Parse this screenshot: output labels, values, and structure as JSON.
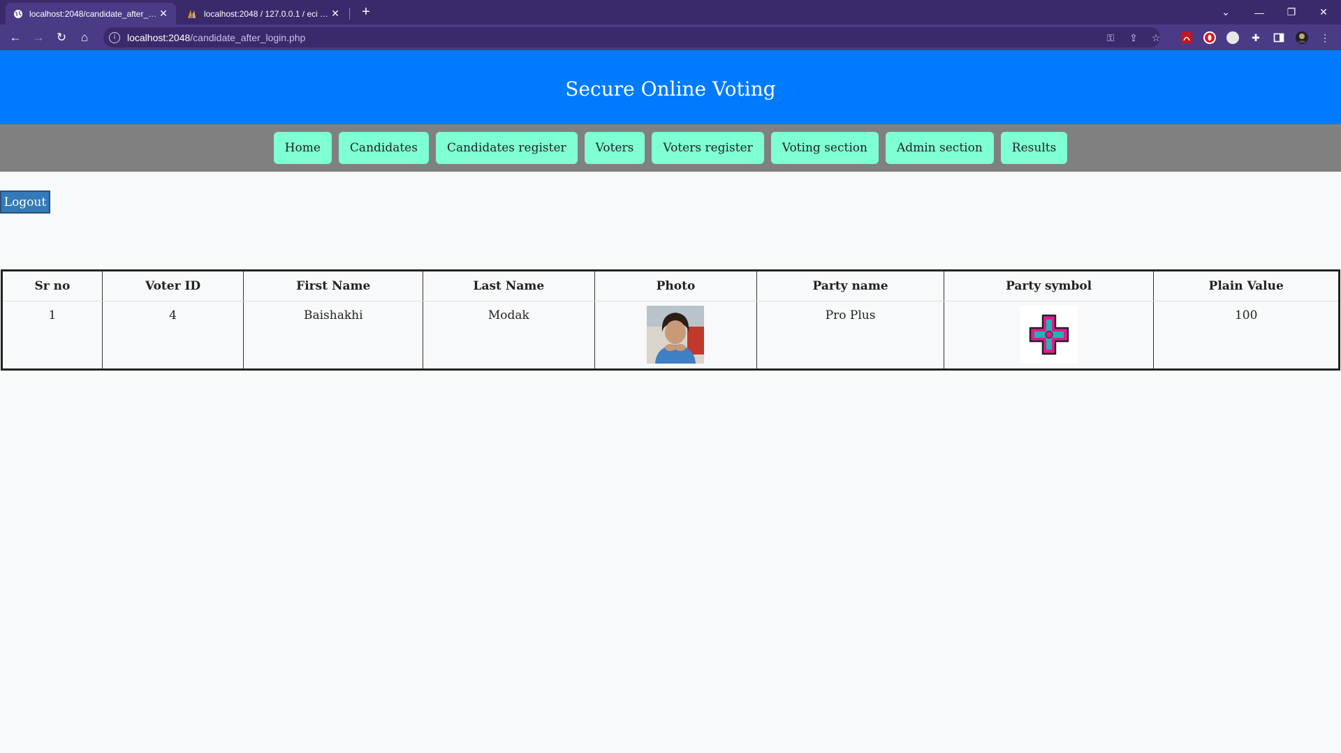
{
  "browser": {
    "tabs": [
      {
        "title": "localhost:2048/candidate_after_login.php",
        "active": true
      },
      {
        "title": "localhost:2048 / 127.0.0.1 / eci / admin",
        "active": false
      }
    ],
    "url_host": "localhost:2048",
    "url_path": "/candidate_after_login.php"
  },
  "header": {
    "title": "Secure Online Voting"
  },
  "nav": {
    "items": [
      "Home",
      "Candidates",
      "Candidates register",
      "Voters",
      "Voters register",
      "Voting section",
      "Admin section",
      "Results"
    ]
  },
  "logout_label": "Logout",
  "table": {
    "headers": [
      "Sr no",
      "Voter ID",
      "First Name",
      "Last Name",
      "Photo",
      "Party name",
      "Party symbol",
      "Plain Value"
    ],
    "rows": [
      {
        "sr_no": "1",
        "voter_id": "4",
        "first_name": "Baishakhi",
        "last_name": "Modak",
        "party_name": "Pro Plus",
        "plain_value": "100"
      }
    ]
  },
  "colors": {
    "header_bg": "#007bff",
    "nav_bg": "#808080",
    "nav_button_bg": "#7fffd4",
    "logout_bg": "#337ab7",
    "browser_frame": "#3b2a6b"
  }
}
